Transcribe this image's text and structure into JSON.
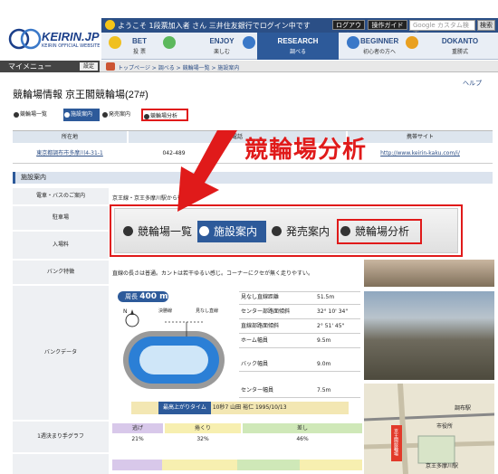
{
  "header": {
    "logo_text": "KEIRIN.JP",
    "logo_sub": "KEIRIN OFFICIAL WEBSITE",
    "welcome": "ようこそ 1段票加入者 さん 三井住友銀行でログイン中です",
    "logout_label": "ログアウト",
    "guide_label": "操作ガイド",
    "search_placeholder": "Google カスタム検索",
    "search_button": "検索"
  },
  "nav": {
    "items": [
      {
        "label": "BET",
        "sub": "投 票"
      },
      {
        "label": "ENJOY",
        "sub": "楽しむ"
      },
      {
        "label": "RESEARCH",
        "sub": "調べる"
      },
      {
        "label": "BEGINNER",
        "sub": "初心者の方へ"
      },
      {
        "label": "DOKANTO",
        "sub": "重勝式"
      }
    ]
  },
  "subbar": {
    "mymenu": "マイメニュー",
    "settings": "設定",
    "breadcrumb": "トップページ > 調べる > 競輪場一覧 > 施設案内"
  },
  "page": {
    "title": "競輪場情報  京王閣競輪場(27#)",
    "help": "ヘルプ"
  },
  "tabs": [
    "競輪場一覧",
    "施設案内",
    "発売案内",
    "競輪場分析"
  ],
  "info_table": {
    "headers": [
      "所在地",
      "電話",
      "携帯サイト"
    ],
    "values": [
      "東京都調布市多摩川4-31-1",
      "042-489",
      "http://www.keirin-kaku.com/i/"
    ]
  },
  "annotation": {
    "big_text": "競輪場分析"
  },
  "section": {
    "title": "施設案内"
  },
  "rows": [
    {
      "label": "電車・バスのご案内",
      "value": "京王線・京王多摩川駅から徒歩1分"
    },
    {
      "label": "駐車場",
      "value": ""
    },
    {
      "label": "入場料",
      "value": ""
    },
    {
      "label": "バンク特徴",
      "value": "直線の長さは普通。カントは若干ゆるい感じ。コーナーにクセが無く走りやすい。"
    },
    {
      "label": "バンクデータ",
      "value": ""
    },
    {
      "label": "1週決まり手グラフ",
      "value": ""
    }
  ],
  "zoom_tabs": [
    "競輪場一覧",
    "施設案内",
    "発売案内",
    "競輪場分析"
  ],
  "track": {
    "length_label": "周長",
    "length_value": "400 m",
    "north": "N",
    "finish_label": "決勝線",
    "straight_label": "見なし直線"
  },
  "bank_data": [
    {
      "label": "見なし直線距離",
      "value": "51.5m"
    },
    {
      "label": "センター部路面傾斜",
      "value": "32° 10' 34\""
    },
    {
      "label": "直線部路面傾斜",
      "value": "2° 51' 45\""
    },
    {
      "label": "ホーム幅員",
      "value": "9.5m"
    },
    {
      "label": "バック幅員",
      "value": "9.0m"
    },
    {
      "label": "センター幅員",
      "value": "7.5m"
    }
  ],
  "best_time": {
    "label": "最高上がりタイム",
    "value": "10秒7 山田  裕仁 1995/10/13"
  },
  "stats": [
    {
      "label": "逃げ",
      "value": "21%",
      "color": "#d8c8ea"
    },
    {
      "label": "捲くり",
      "value": "32%",
      "color": "#f7efb0"
    },
    {
      "label": "差し",
      "value": "46%",
      "color": "#cfe8b8"
    }
  ],
  "map_labels": [
    "調布駅",
    "市役所",
    "京王多摩川駅",
    "京王閣競輪場"
  ],
  "colors": {
    "accent": "#2d5a9a",
    "highlight": "#e01a1a"
  }
}
